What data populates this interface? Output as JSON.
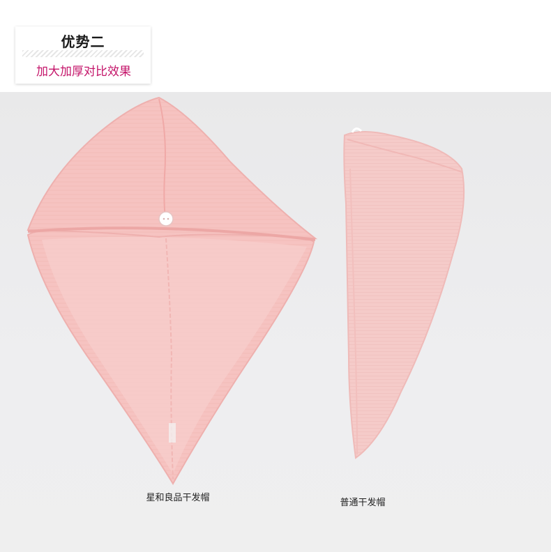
{
  "header": {
    "title": "优势二",
    "subtitle": "加大加厚对比效果"
  },
  "captions": {
    "left": "星和良品干发帽",
    "right": "普通干发帽"
  },
  "colors": {
    "towel_pink": "#f7c6c4",
    "subtitle_magenta": "#c4156a",
    "background_gray": "#ececee"
  }
}
